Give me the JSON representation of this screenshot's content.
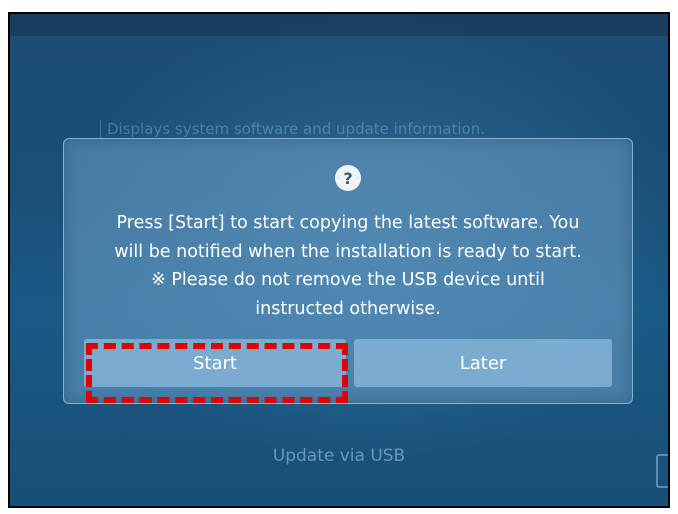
{
  "background": {
    "description_text": "Displays system software and update information.",
    "usb_label": "Update via USB"
  },
  "dialog": {
    "icon": "question-icon",
    "icon_glyph": "?",
    "message_lines": [
      "Press [Start] to start copying the latest software. You",
      "will be notified when the installation is ready to start.",
      "※ Please do not remove the USB device until",
      "instructed otherwise."
    ],
    "start_label": "Start",
    "later_label": "Later"
  },
  "colors": {
    "highlight": "#e00000",
    "screen_background": "#1a4f78",
    "dialog_background": "#6ea0c8"
  }
}
